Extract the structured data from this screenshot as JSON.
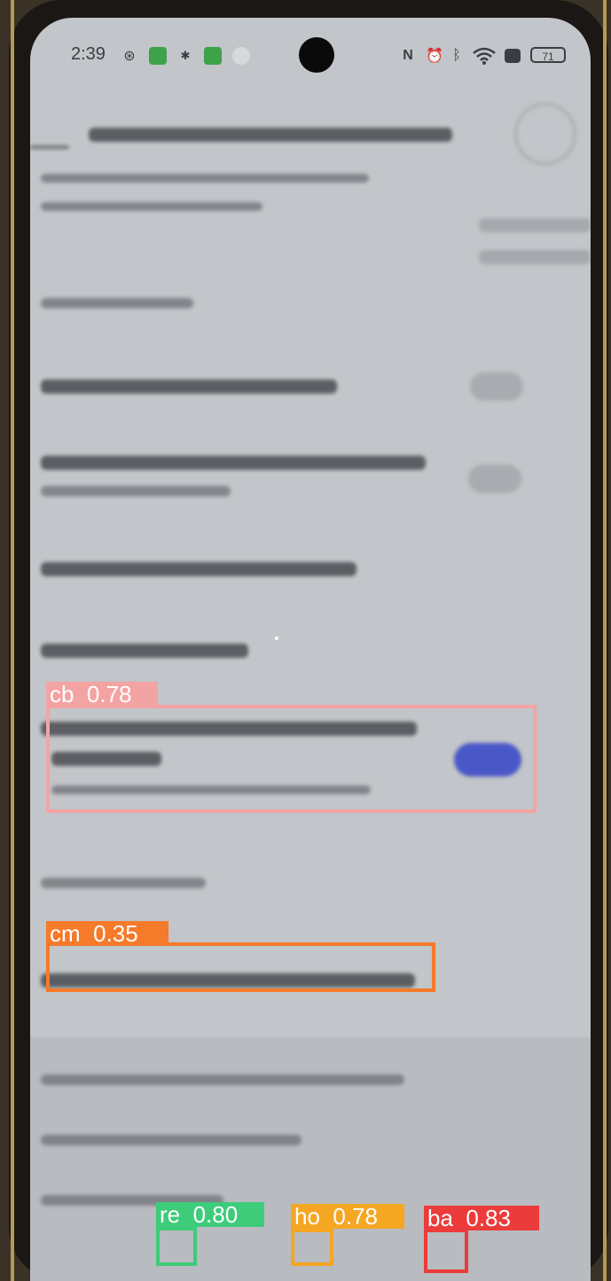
{
  "status_bar": {
    "time": "2:39",
    "battery": "71",
    "left_icons": [
      "steering-icon",
      "app-badge-icon",
      "bug-icon",
      "app-badge-icon",
      "minus-icon"
    ],
    "right_icons": [
      "nfc-icon",
      "alarm-icon",
      "bluetooth-icon",
      "wifi-icon",
      "close-box-icon"
    ]
  },
  "detections": {
    "cb": {
      "label": "cb  0.78",
      "class": "cb",
      "score": 0.78,
      "color": "#f4a3a3"
    },
    "cm": {
      "label": "cm  0.35",
      "class": "cm",
      "score": 0.35,
      "color": "#f57a2a"
    },
    "re": {
      "label": "re  0.80",
      "class": "re",
      "score": 0.8,
      "color": "#3ecb7a"
    },
    "ho": {
      "label": "ho  0.78",
      "class": "ho",
      "score": 0.78,
      "color": "#f5a623"
    },
    "ba": {
      "label": "ba  0.83",
      "class": "ba",
      "score": 0.83,
      "color": "#ec3b3b"
    }
  },
  "toggles": {
    "row_a": "off",
    "row_b": "off",
    "checked_row": "on"
  },
  "colors": {
    "screen_bg": "#c2c5c9",
    "toggle_on": "#4a57c7"
  }
}
